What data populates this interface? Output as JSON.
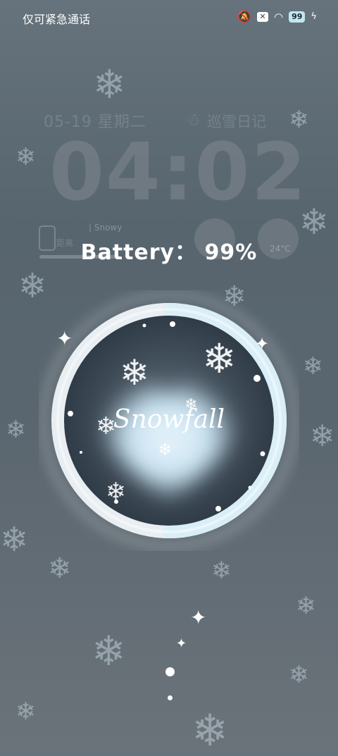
{
  "status_bar": {
    "emergency_text": "仅可紧急通话",
    "battery_level": "99"
  },
  "lockscreen": {
    "date_text": "05-19  星期二",
    "diary_text": "巡雪日记",
    "time": "04:02",
    "weather_label": "| Snowy",
    "distance_label": "距离",
    "temperature": "24°C"
  },
  "battery_overlay": {
    "text": "Battery： 99%",
    "level_percent": 99
  },
  "animation": {
    "title": "Snowfall"
  },
  "colors": {
    "ring_light": "#f2f6f9",
    "ring_accent": "#d9eef7",
    "heart_glow": "#c9e3f2"
  }
}
